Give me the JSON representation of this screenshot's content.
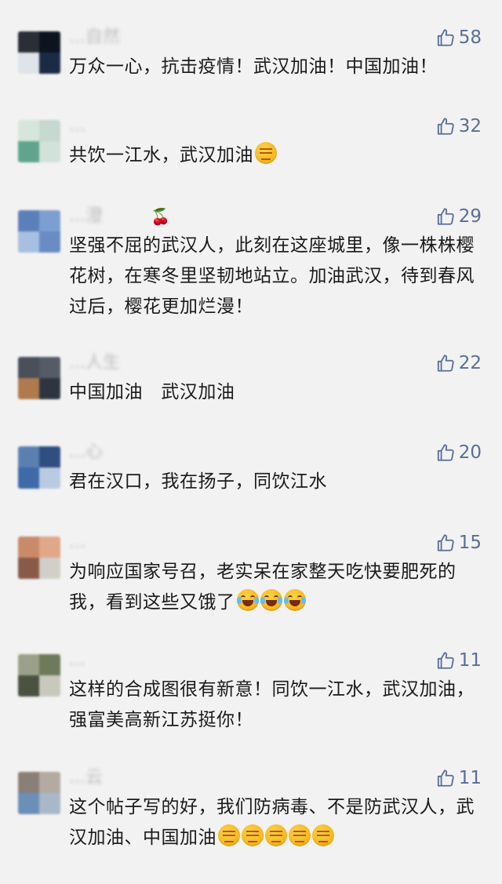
{
  "comments": [
    {
      "name": "...自然",
      "name_extra": "",
      "likes": "58",
      "text": "万众一心，抗击疫情！武汉加油！中国加油！",
      "emojis": [],
      "avatar_colors": [
        "#2b2e36",
        "#0c1420",
        "#dfe3ea",
        "#1b2b44"
      ]
    },
    {
      "name": "...",
      "name_extra": "",
      "likes": "32",
      "text": "共饮一江水，武汉加油",
      "emojis": [
        "fist"
      ],
      "avatar_colors": [
        "#d7e6dc",
        "#c6d8cf",
        "#5fa58e",
        "#d2e2da"
      ]
    },
    {
      "name": "...澄",
      "name_extra": "🍒",
      "likes": "29",
      "text": "坚强不屈的武汉人，此刻在这座城里，像一株株樱花树，在寒冬里坚韧地站立。加油武汉，待到春风过后，樱花更加烂漫！",
      "emojis": [],
      "avatar_colors": [
        "#5b7fb9",
        "#7c9fd1",
        "#a7bfe0",
        "#6a8bc4"
      ]
    },
    {
      "name": "...人生",
      "name_extra": "",
      "likes": "22",
      "text": "中国加油   武汉加油",
      "emojis": [],
      "avatar_colors": [
        "#4a4f5a",
        "#565c66",
        "#b07a4e",
        "#2f3540"
      ]
    },
    {
      "name": "...心",
      "name_extra": "",
      "likes": "20",
      "text": "君在汉口，我在扬子，同饮江水",
      "emojis": [],
      "avatar_colors": [
        "#5c7fb0",
        "#2f4f80",
        "#3e6aa8",
        "#b9cbe0"
      ]
    },
    {
      "name": "...",
      "name_extra": "",
      "likes": "15",
      "text": "为响应国家号召，老实呆在家整天吃快要肥死的我，看到这些又饿了",
      "emojis": [
        "laugh",
        "laugh",
        "laugh"
      ],
      "avatar_colors": [
        "#c98a6a",
        "#e0a888",
        "#8a5a48",
        "#d2cfc8"
      ]
    },
    {
      "name": "...",
      "name_extra": "",
      "likes": "11",
      "text": "这样的合成图很有新意！同饮一江水，武汉加油，强富美高新江苏挺你！",
      "emojis": [],
      "avatar_colors": [
        "#9aa08a",
        "#6e7a5a",
        "#4a5240",
        "#c8c9bc"
      ]
    },
    {
      "name": "...云",
      "name_extra": "",
      "likes": "11",
      "text": "这个帖子写的好，我们防病毒、不是防武汉人，武汉加油、中国加油",
      "emojis": [
        "fist",
        "fist",
        "fist",
        "fist",
        "fist"
      ],
      "avatar_colors": [
        "#8a7f78",
        "#b3aaa2",
        "#6c8fb8",
        "#a8b8c8"
      ]
    }
  ],
  "icons": {
    "like": "thumbs-up-icon"
  },
  "colors": {
    "like": "#5a6e95",
    "background": "#f2f2f2"
  }
}
